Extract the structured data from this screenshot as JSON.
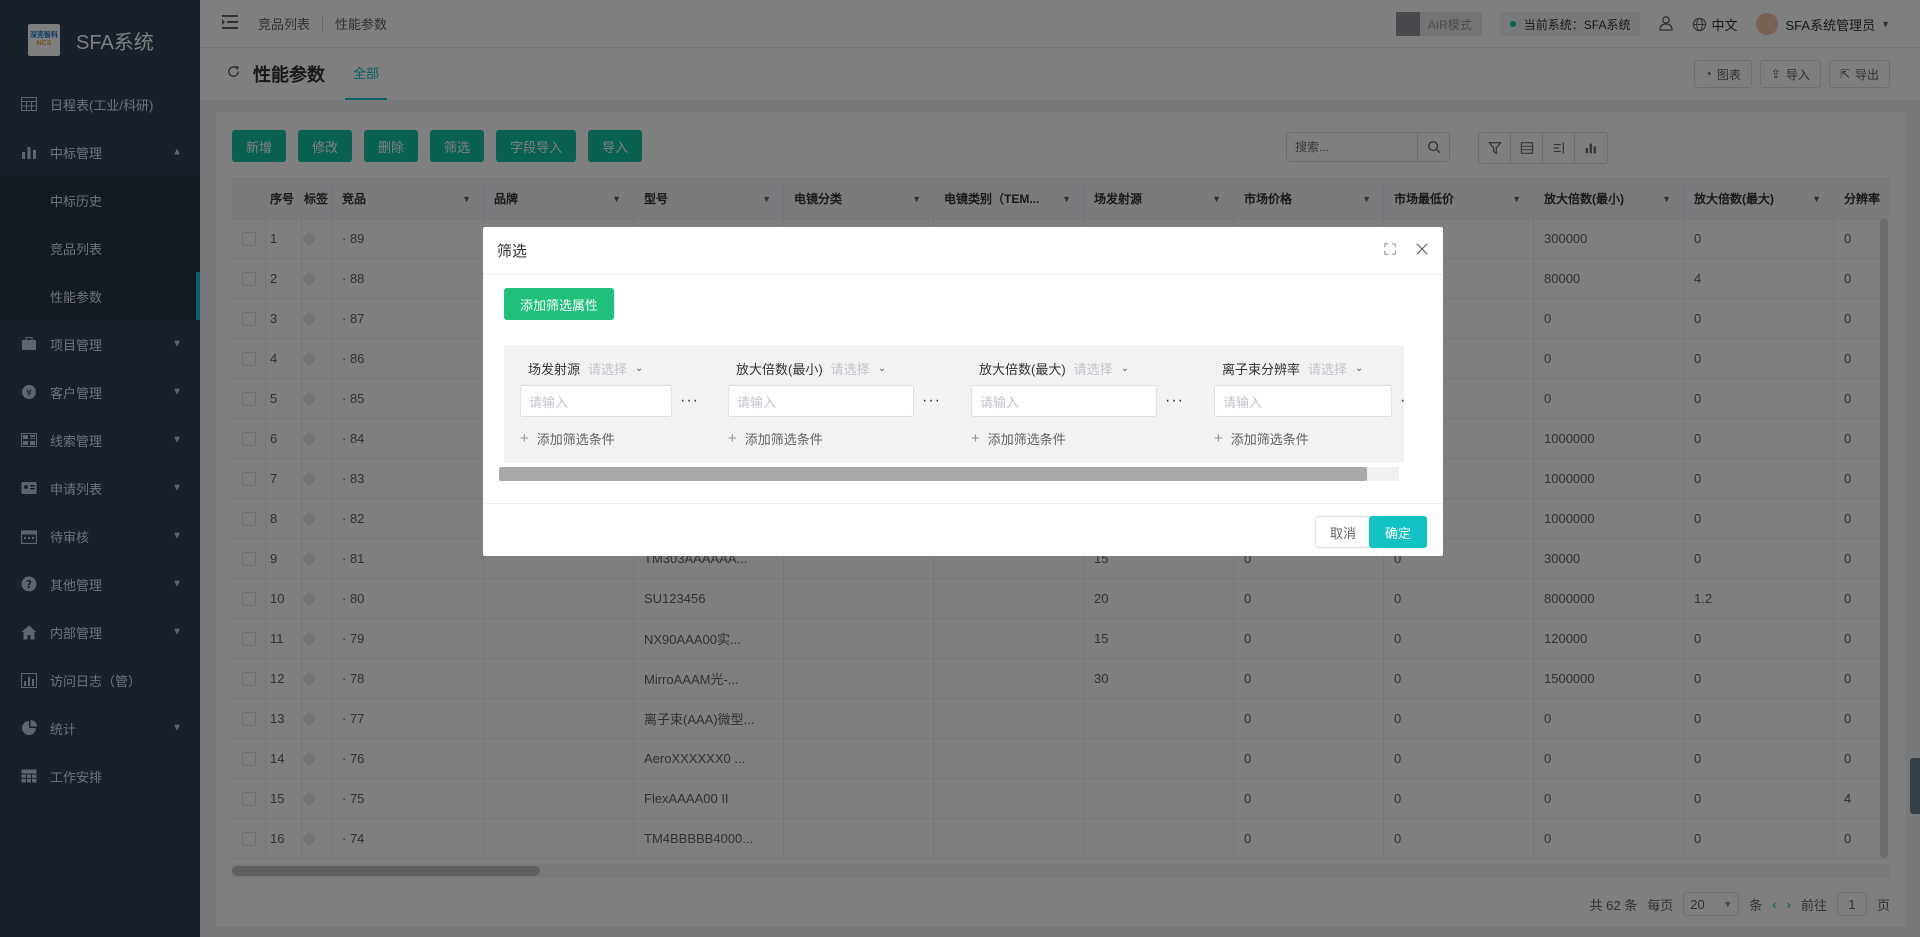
{
  "app": {
    "logo_top": "深亮智科",
    "logo_bottom": "NCS",
    "title": "SFA系统"
  },
  "sidebar": {
    "items": [
      {
        "label": "日程表(工业/科研)",
        "icon": "calendar-table-icon"
      },
      {
        "label": "中标管理",
        "icon": "bar-chart-icon",
        "expanded": true,
        "children": [
          {
            "label": "中标历史"
          },
          {
            "label": "竞品列表"
          },
          {
            "label": "性能参数",
            "active": true
          }
        ]
      },
      {
        "label": "项目管理",
        "icon": "briefcase-icon"
      },
      {
        "label": "客户管理",
        "icon": "yen-icon"
      },
      {
        "label": "线索管理",
        "icon": "grid-icon"
      },
      {
        "label": "申请列表",
        "icon": "id-card-icon"
      },
      {
        "label": "待审核",
        "icon": "calendar-icon"
      },
      {
        "label": "其他管理",
        "icon": "question-icon"
      },
      {
        "label": "内部管理",
        "icon": "home-icon"
      },
      {
        "label": "访问日志（管）",
        "icon": "chart-box-icon"
      },
      {
        "label": "统计",
        "icon": "pie-icon"
      },
      {
        "label": "工作安排",
        "icon": "table-icon"
      }
    ]
  },
  "header": {
    "breadcrumb": [
      "竞品列表",
      "性能参数"
    ],
    "air_mode": "AIR模式",
    "current_system": "当前系统：SFA系统",
    "language": "中文",
    "user": "SFA系统管理员"
  },
  "titlebar": {
    "title": "性能参数",
    "tab": "全部",
    "actions": [
      "图表",
      "导入",
      "导出"
    ]
  },
  "toolbar": {
    "buttons": [
      "新增",
      "修改",
      "删除",
      "筛选",
      "字段导入",
      "导入"
    ],
    "search_placeholder": "搜索..."
  },
  "table": {
    "columns": [
      "序号",
      "标签",
      "竞品",
      "品牌",
      "型号",
      "电镜分类",
      "电镜类别（TEM...",
      "场发射源",
      "市场价格",
      "市场最低价",
      "放大倍数(最小)",
      "放大倍数(最大)",
      "分辨率"
    ],
    "rows": [
      [
        "1",
        "",
        "· 89",
        "",
        "",
        "",
        "",
        "",
        "",
        "",
        "300000",
        "0",
        "0"
      ],
      [
        "2",
        "",
        "· 88",
        "",
        "",
        "",
        "",
        "",
        "",
        "",
        "80000",
        "4",
        "0"
      ],
      [
        "3",
        "",
        "· 87",
        "",
        "",
        "",
        "",
        "",
        "",
        "",
        "0",
        "0",
        "0"
      ],
      [
        "4",
        "",
        "· 86",
        "",
        "",
        "",
        "",
        "",
        "",
        "",
        "0",
        "0",
        "0"
      ],
      [
        "5",
        "",
        "· 85",
        "",
        "",
        "",
        "",
        "",
        "",
        "",
        "0",
        "0",
        "0"
      ],
      [
        "6",
        "",
        "· 84",
        "",
        "",
        "",
        "",
        "",
        "",
        "",
        "1000000",
        "0",
        "0"
      ],
      [
        "7",
        "",
        "· 83",
        "",
        "",
        "",
        "",
        "",
        "",
        "",
        "1000000",
        "0",
        "0"
      ],
      [
        "8",
        "",
        "· 82",
        "",
        "",
        "",
        "",
        "",
        "",
        "",
        "1000000",
        "0",
        "0"
      ],
      [
        "9",
        "",
        "· 81",
        "",
        "TM303AAAAAA...",
        "",
        "",
        "15",
        "0",
        "0",
        "30000",
        "0",
        "0"
      ],
      [
        "10",
        "",
        "· 80",
        "",
        "SU123456",
        "",
        "",
        "20",
        "0",
        "0",
        "8000000",
        "1.2",
        "0"
      ],
      [
        "11",
        "",
        "· 79",
        "",
        "NX90AAA00实...",
        "",
        "",
        "15",
        "0",
        "0",
        "120000",
        "0",
        "0"
      ],
      [
        "12",
        "",
        "· 78",
        "",
        "MirroAAAM光-...",
        "",
        "",
        "30",
        "0",
        "0",
        "1500000",
        "0",
        "0"
      ],
      [
        "13",
        "",
        "· 77",
        "",
        "离子束(AAA)微型...",
        "",
        "",
        "",
        "0",
        "0",
        "0",
        "0",
        "0"
      ],
      [
        "14",
        "",
        "· 76",
        "",
        "AeroXXXXXX0 ...",
        "",
        "",
        "",
        "0",
        "0",
        "0",
        "0",
        "0"
      ],
      [
        "15",
        "",
        "· 75",
        "",
        "FlexAAAA00 II",
        "",
        "",
        "",
        "0",
        "0",
        "0",
        "0",
        "4"
      ],
      [
        "16",
        "",
        "· 74",
        "",
        "TM4BBBBB4000...",
        "",
        "",
        "",
        "0",
        "0",
        "0",
        "0",
        "0"
      ]
    ]
  },
  "pagination": {
    "total": "共 62 条",
    "per_page_label": "每页",
    "per_page": "20",
    "unit": "条",
    "goto_label": "前往",
    "page": "1",
    "page_suffix": "页"
  },
  "dialog": {
    "title": "筛选",
    "add_attr": "添加筛选属性",
    "filters": [
      {
        "field": "场发射源",
        "select_placeholder": "请选择",
        "input_placeholder": "请输入",
        "add_condition": "添加筛选条件"
      },
      {
        "field": "放大倍数(最小)",
        "select_placeholder": "请选择",
        "input_placeholder": "请输入",
        "add_condition": "添加筛选条件"
      },
      {
        "field": "放大倍数(最大)",
        "select_placeholder": "请选择",
        "input_placeholder": "请输入",
        "add_condition": "添加筛选条件"
      },
      {
        "field": "离子束分辨率",
        "select_placeholder": "请选择",
        "input_placeholder": "请输入",
        "add_condition": "添加筛选条件"
      }
    ],
    "cancel": "取消",
    "confirm": "确定"
  },
  "colors": {
    "sidebar_bg": "#304156",
    "accent": "#13c2c2",
    "primary_button": "#13c2a3",
    "add_attr_button": "#1ec07a"
  }
}
